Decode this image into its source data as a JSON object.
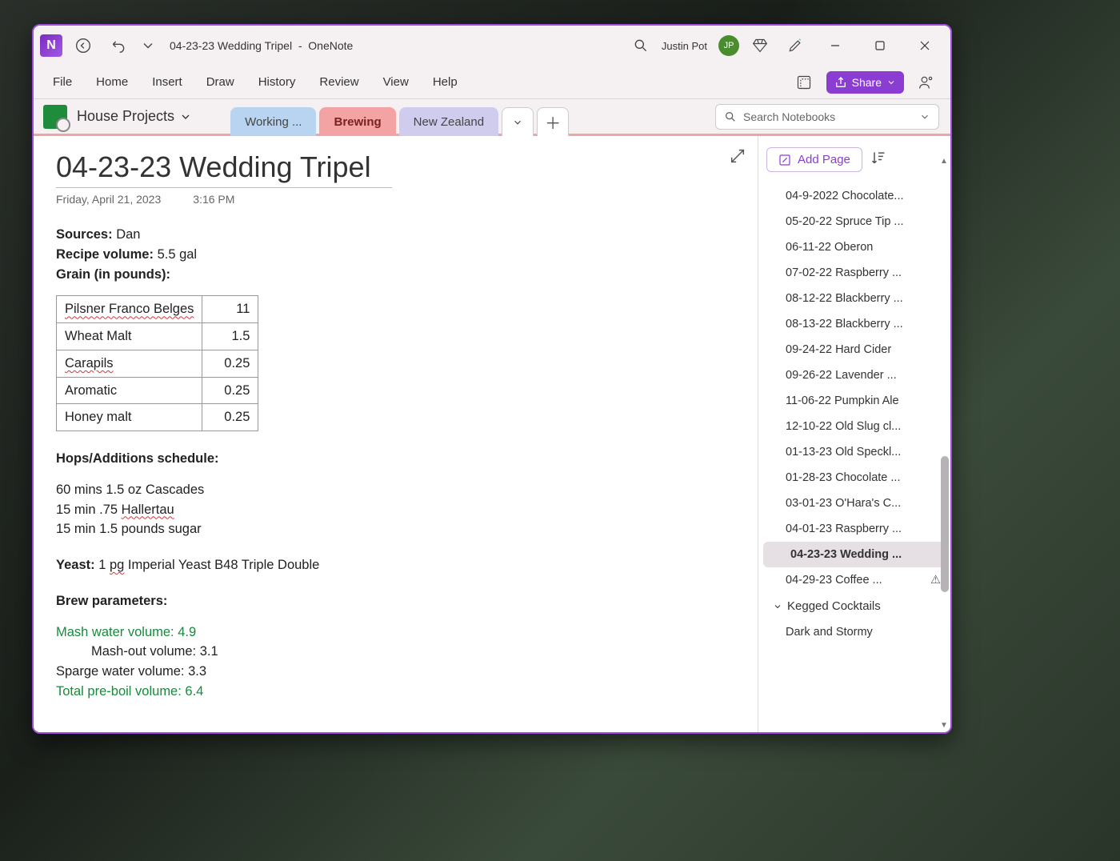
{
  "titlebar": {
    "doc_title": "04-23-23 Wedding Tripel",
    "sep": "-",
    "app_name": "OneNote",
    "user_name": "Justin Pot",
    "user_initials": "JP"
  },
  "ribbon": {
    "tabs": [
      "File",
      "Home",
      "Insert",
      "Draw",
      "History",
      "Review",
      "View",
      "Help"
    ],
    "share_label": "Share"
  },
  "nav": {
    "notebook": "House Projects",
    "sections": [
      {
        "label": "Working ...",
        "cls": "blue"
      },
      {
        "label": "Brewing",
        "cls": "red"
      },
      {
        "label": "New Zealand",
        "cls": "purple"
      }
    ],
    "search_placeholder": "Search Notebooks"
  },
  "note": {
    "title": "04-23-23 Wedding Tripel",
    "date": "Friday, April 21, 2023",
    "time": "3:16 PM",
    "sources_label": "Sources:",
    "sources_value": "Dan",
    "volume_label": "Recipe volume:",
    "volume_value": "5.5 gal",
    "grain_label": "Grain (in pounds):",
    "grain_table": [
      {
        "name": "Pilsner Franco Belges",
        "amt": "11",
        "spell": true
      },
      {
        "name": "Wheat Malt",
        "amt": "1.5",
        "spell": false
      },
      {
        "name": "Carapils",
        "amt": "0.25",
        "spell": true
      },
      {
        "name": "Aromatic",
        "amt": "0.25",
        "spell": false
      },
      {
        "name": "Honey malt",
        "amt": "0.25",
        "spell": false
      }
    ],
    "hops_label": "Hops/Additions schedule:",
    "hops_lines": [
      "60 mins 1.5 oz Cascades",
      "15 min .75 Hallertau",
      "15 min 1.5 pounds sugar"
    ],
    "yeast_label": "Yeast:",
    "yeast_value": "1 pg Imperial Yeast B48 Triple Double",
    "brew_label": "Brew parameters:",
    "mash_water": "Mash water volume: 4.9",
    "mash_out": "Mash-out volume: 3.1",
    "sparge": "Sparge water volume: 3.3",
    "preboil": "Total pre-boil volume: 6.4"
  },
  "pages": {
    "add_label": "Add Page",
    "items": [
      {
        "label": "04-9-2022 Chocolate..."
      },
      {
        "label": "05-20-22 Spruce Tip ..."
      },
      {
        "label": "06-11-22 Oberon"
      },
      {
        "label": "07-02-22 Raspberry ..."
      },
      {
        "label": "08-12-22 Blackberry ..."
      },
      {
        "label": "08-13-22 Blackberry ..."
      },
      {
        "label": "09-24-22 Hard Cider"
      },
      {
        "label": "09-26-22 Lavender ..."
      },
      {
        "label": "11-06-22 Pumpkin Ale"
      },
      {
        "label": "12-10-22 Old Slug cl..."
      },
      {
        "label": "01-13-23 Old Speckl..."
      },
      {
        "label": "01-28-23 Chocolate ..."
      },
      {
        "label": "03-01-23 O'Hara's C..."
      },
      {
        "label": "04-01-23 Raspberry ..."
      },
      {
        "label": "04-23-23 Wedding ...",
        "selected": true
      },
      {
        "label": "04-29-23 Coffee ...",
        "warn": true
      }
    ],
    "group_header": "Kegged Cocktails",
    "sub_item": "Dark and Stormy"
  }
}
